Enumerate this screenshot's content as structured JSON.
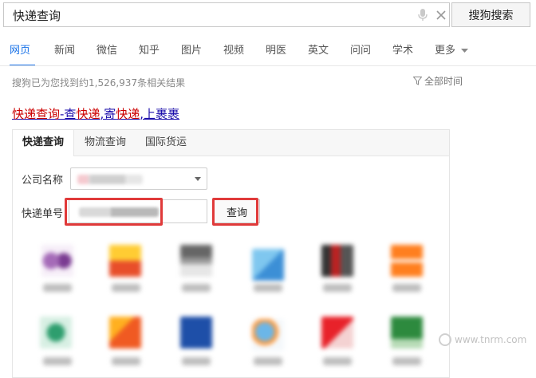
{
  "search": {
    "query": "快递查询",
    "button_label": "搜狗搜索"
  },
  "nav": {
    "tabs": [
      "网页",
      "新闻",
      "微信",
      "知乎",
      "图片",
      "视频",
      "明医",
      "英文",
      "问问",
      "学术",
      "更多"
    ],
    "active": "网页"
  },
  "results": {
    "count_text": "搜狗已为您找到约1,526,937条相关结果",
    "time_filter": "全部时间"
  },
  "result": {
    "title_part1": "快递查询",
    "title_part2": "-查",
    "title_part3": "快递",
    "title_part4": ",寄",
    "title_part5": "快递",
    "title_part6": ",上裹裹"
  },
  "widget": {
    "tabs": [
      "快递查询",
      "物流查询",
      "国际货运"
    ],
    "company_label": "公司名称",
    "tracking_label": "快递单号",
    "query_button": "查询",
    "tracking_partial": "120020332"
  },
  "colors": {
    "accent": "#1a73e8",
    "highlight": "#e03a3a",
    "link": "#1a0dab",
    "keyword": "#cc0000"
  },
  "watermark": "www.tnrm.com"
}
